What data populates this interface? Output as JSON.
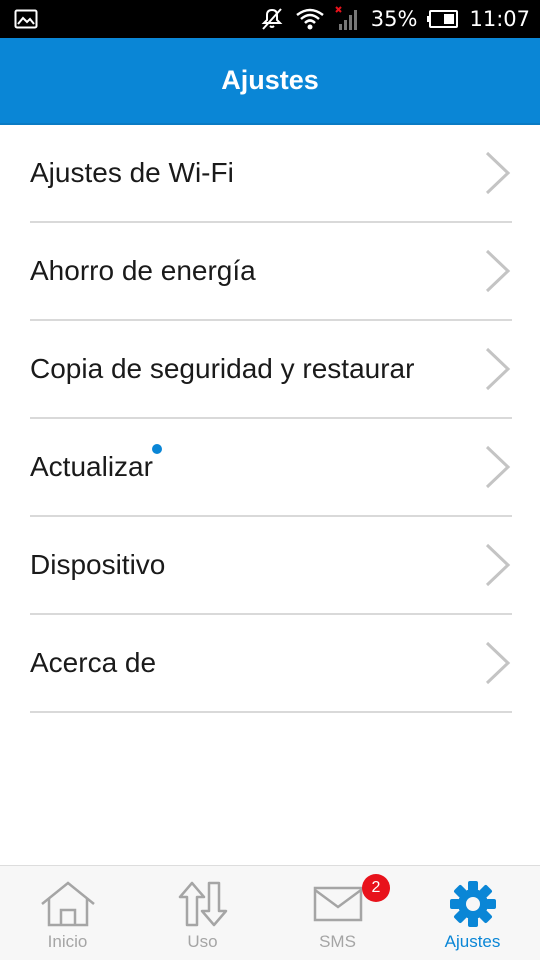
{
  "status_bar": {
    "battery_percent": "35%",
    "time": "11:07",
    "icons": [
      "gallery-icon",
      "mute-icon",
      "wifi-icon",
      "signal-icon",
      "battery-icon"
    ]
  },
  "header": {
    "title": "Ajustes",
    "color": "#0a86d6"
  },
  "settings": {
    "items": [
      {
        "label": "Ajustes de Wi-Fi"
      },
      {
        "label": "Ahorro de energía"
      },
      {
        "label": "Copia de seguridad y restaurar"
      },
      {
        "label": "Actualizar",
        "has_notification_dot": true
      },
      {
        "label": "Dispositivo"
      },
      {
        "label": "Acerca de"
      }
    ]
  },
  "bottom_nav": {
    "items": [
      {
        "label": "Inicio",
        "icon": "home-icon",
        "active": false
      },
      {
        "label": "Uso",
        "icon": "usage-arrows-icon",
        "active": false
      },
      {
        "label": "SMS",
        "icon": "envelope-icon",
        "active": false,
        "badge": "2"
      },
      {
        "label": "Ajustes",
        "icon": "gear-icon",
        "active": true
      }
    ],
    "active_color": "#0a86d6",
    "inactive_color": "#a5a5a5",
    "badge_color": "#e8121b"
  }
}
